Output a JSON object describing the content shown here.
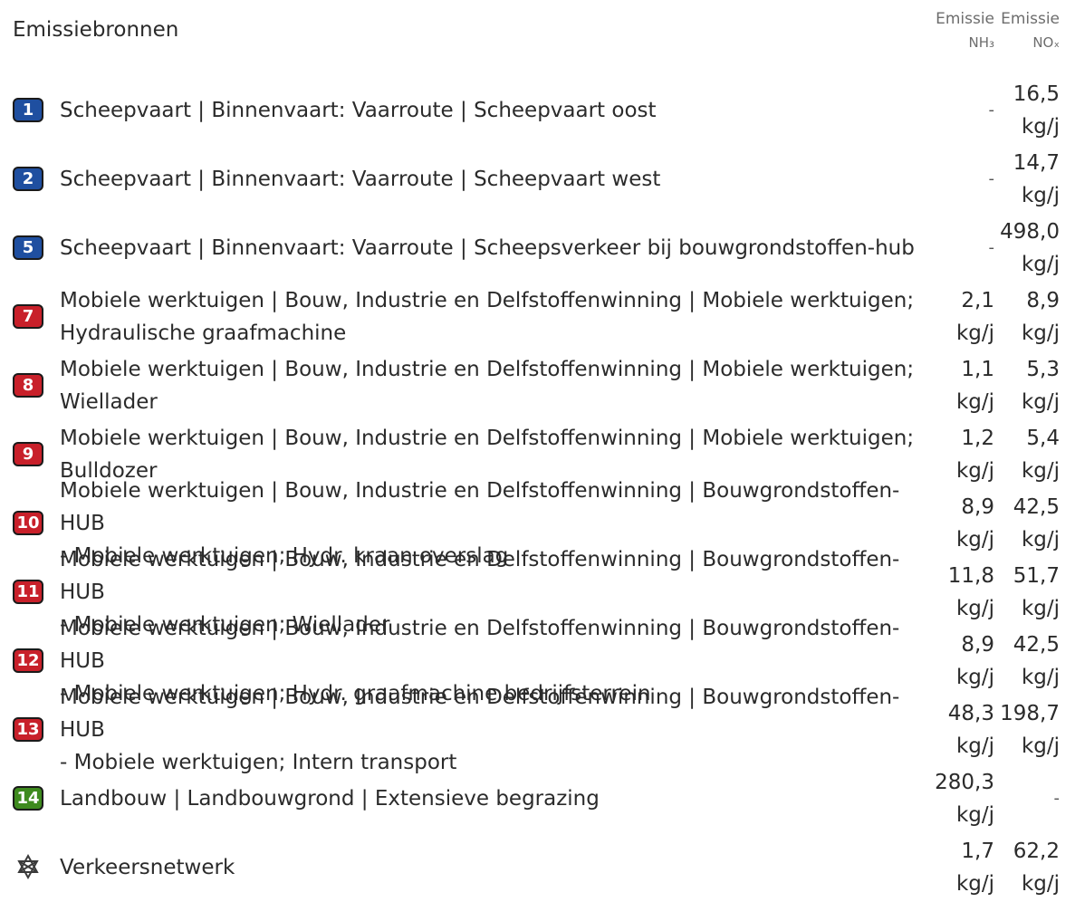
{
  "header": {
    "title": "Emissiebronnen",
    "col_nh3_top": "Emissie",
    "col_nh3_sub": "NH₃",
    "col_nox_top": "Emissie",
    "col_nox_sub": "NOₓ"
  },
  "colors": {
    "blue": "#1f4fa0",
    "red": "#c8202a",
    "green": "#3e8a1e"
  },
  "rows": [
    {
      "badge": "1",
      "color": "blue",
      "line1": "Scheepvaart | Binnenvaart: Vaarroute | Scheepvaart oost",
      "line2": "",
      "nh3": "",
      "nh3_unit": "-",
      "nox": "16,5",
      "nox_unit": "kg/j"
    },
    {
      "badge": "2",
      "color": "blue",
      "line1": "Scheepvaart | Binnenvaart: Vaarroute | Scheepvaart west",
      "line2": "",
      "nh3": "",
      "nh3_unit": "-",
      "nox": "14,7",
      "nox_unit": "kg/j"
    },
    {
      "badge": "5",
      "color": "blue",
      "line1": "Scheepvaart | Binnenvaart: Vaarroute | Scheepsverkeer bij bouwgrondstoffen-hub",
      "line2": "",
      "nh3": "",
      "nh3_unit": "-",
      "nox": "498,0",
      "nox_unit": "kg/j"
    },
    {
      "badge": "7",
      "color": "red",
      "line1": "Mobiele werktuigen | Bouw, Industrie en Delfstoffenwinning | Mobiele werktuigen;",
      "line2": "Hydraulische graafmachine",
      "nh3": "2,1",
      "nh3_unit": "kg/j",
      "nox": "8,9",
      "nox_unit": "kg/j"
    },
    {
      "badge": "8",
      "color": "red",
      "line1": "Mobiele werktuigen | Bouw, Industrie en Delfstoffenwinning | Mobiele werktuigen;",
      "line2": "Wiellader",
      "nh3": "1,1",
      "nh3_unit": "kg/j",
      "nox": "5,3",
      "nox_unit": "kg/j"
    },
    {
      "badge": "9",
      "color": "red",
      "line1": "Mobiele werktuigen | Bouw, Industrie en Delfstoffenwinning | Mobiele werktuigen;",
      "line2": "Bulldozer",
      "nh3": "1,2",
      "nh3_unit": "kg/j",
      "nox": "5,4",
      "nox_unit": "kg/j"
    },
    {
      "badge": "10",
      "color": "red",
      "line1": "Mobiele werktuigen | Bouw, Industrie en Delfstoffenwinning | Bouwgrondstoffen-HUB",
      "line2": "- Mobiele werktuigen; Hydr. kraan overslag",
      "nh3": "8,9",
      "nh3_unit": "kg/j",
      "nox": "42,5",
      "nox_unit": "kg/j"
    },
    {
      "badge": "11",
      "color": "red",
      "line1": "Mobiele werktuigen | Bouw, Industrie en Delfstoffenwinning | Bouwgrondstoffen-HUB",
      "line2": "- Mobiele werktuigen; Wiellader",
      "nh3": "11,8",
      "nh3_unit": "kg/j",
      "nox": "51,7",
      "nox_unit": "kg/j"
    },
    {
      "badge": "12",
      "color": "red",
      "line1": "Mobiele werktuigen | Bouw, Industrie en Delfstoffenwinning | Bouwgrondstoffen-HUB",
      "line2": "- Mobiele werktuigen; Hydr. graafmachine bedrijfsterrein",
      "nh3": "8,9",
      "nh3_unit": "kg/j",
      "nox": "42,5",
      "nox_unit": "kg/j"
    },
    {
      "badge": "13",
      "color": "red",
      "line1": "Mobiele werktuigen | Bouw, Industrie en Delfstoffenwinning | Bouwgrondstoffen-HUB",
      "line2": "- Mobiele werktuigen; Intern transport",
      "nh3": "48,3",
      "nh3_unit": "kg/j",
      "nox": "198,7",
      "nox_unit": "kg/j"
    },
    {
      "badge": "14",
      "color": "green",
      "line1": "Landbouw | Landbouwgrond | Extensieve begrazing",
      "line2": "",
      "nh3": "280,3",
      "nh3_unit": "kg/j",
      "nox": "",
      "nox_unit": "-"
    },
    {
      "badge": "",
      "color": "",
      "icon": "network-icon",
      "line1": "Verkeersnetwerk",
      "line2": "",
      "nh3": "1,7",
      "nh3_unit": "kg/j",
      "nox": "62,2",
      "nox_unit": "kg/j"
    }
  ]
}
